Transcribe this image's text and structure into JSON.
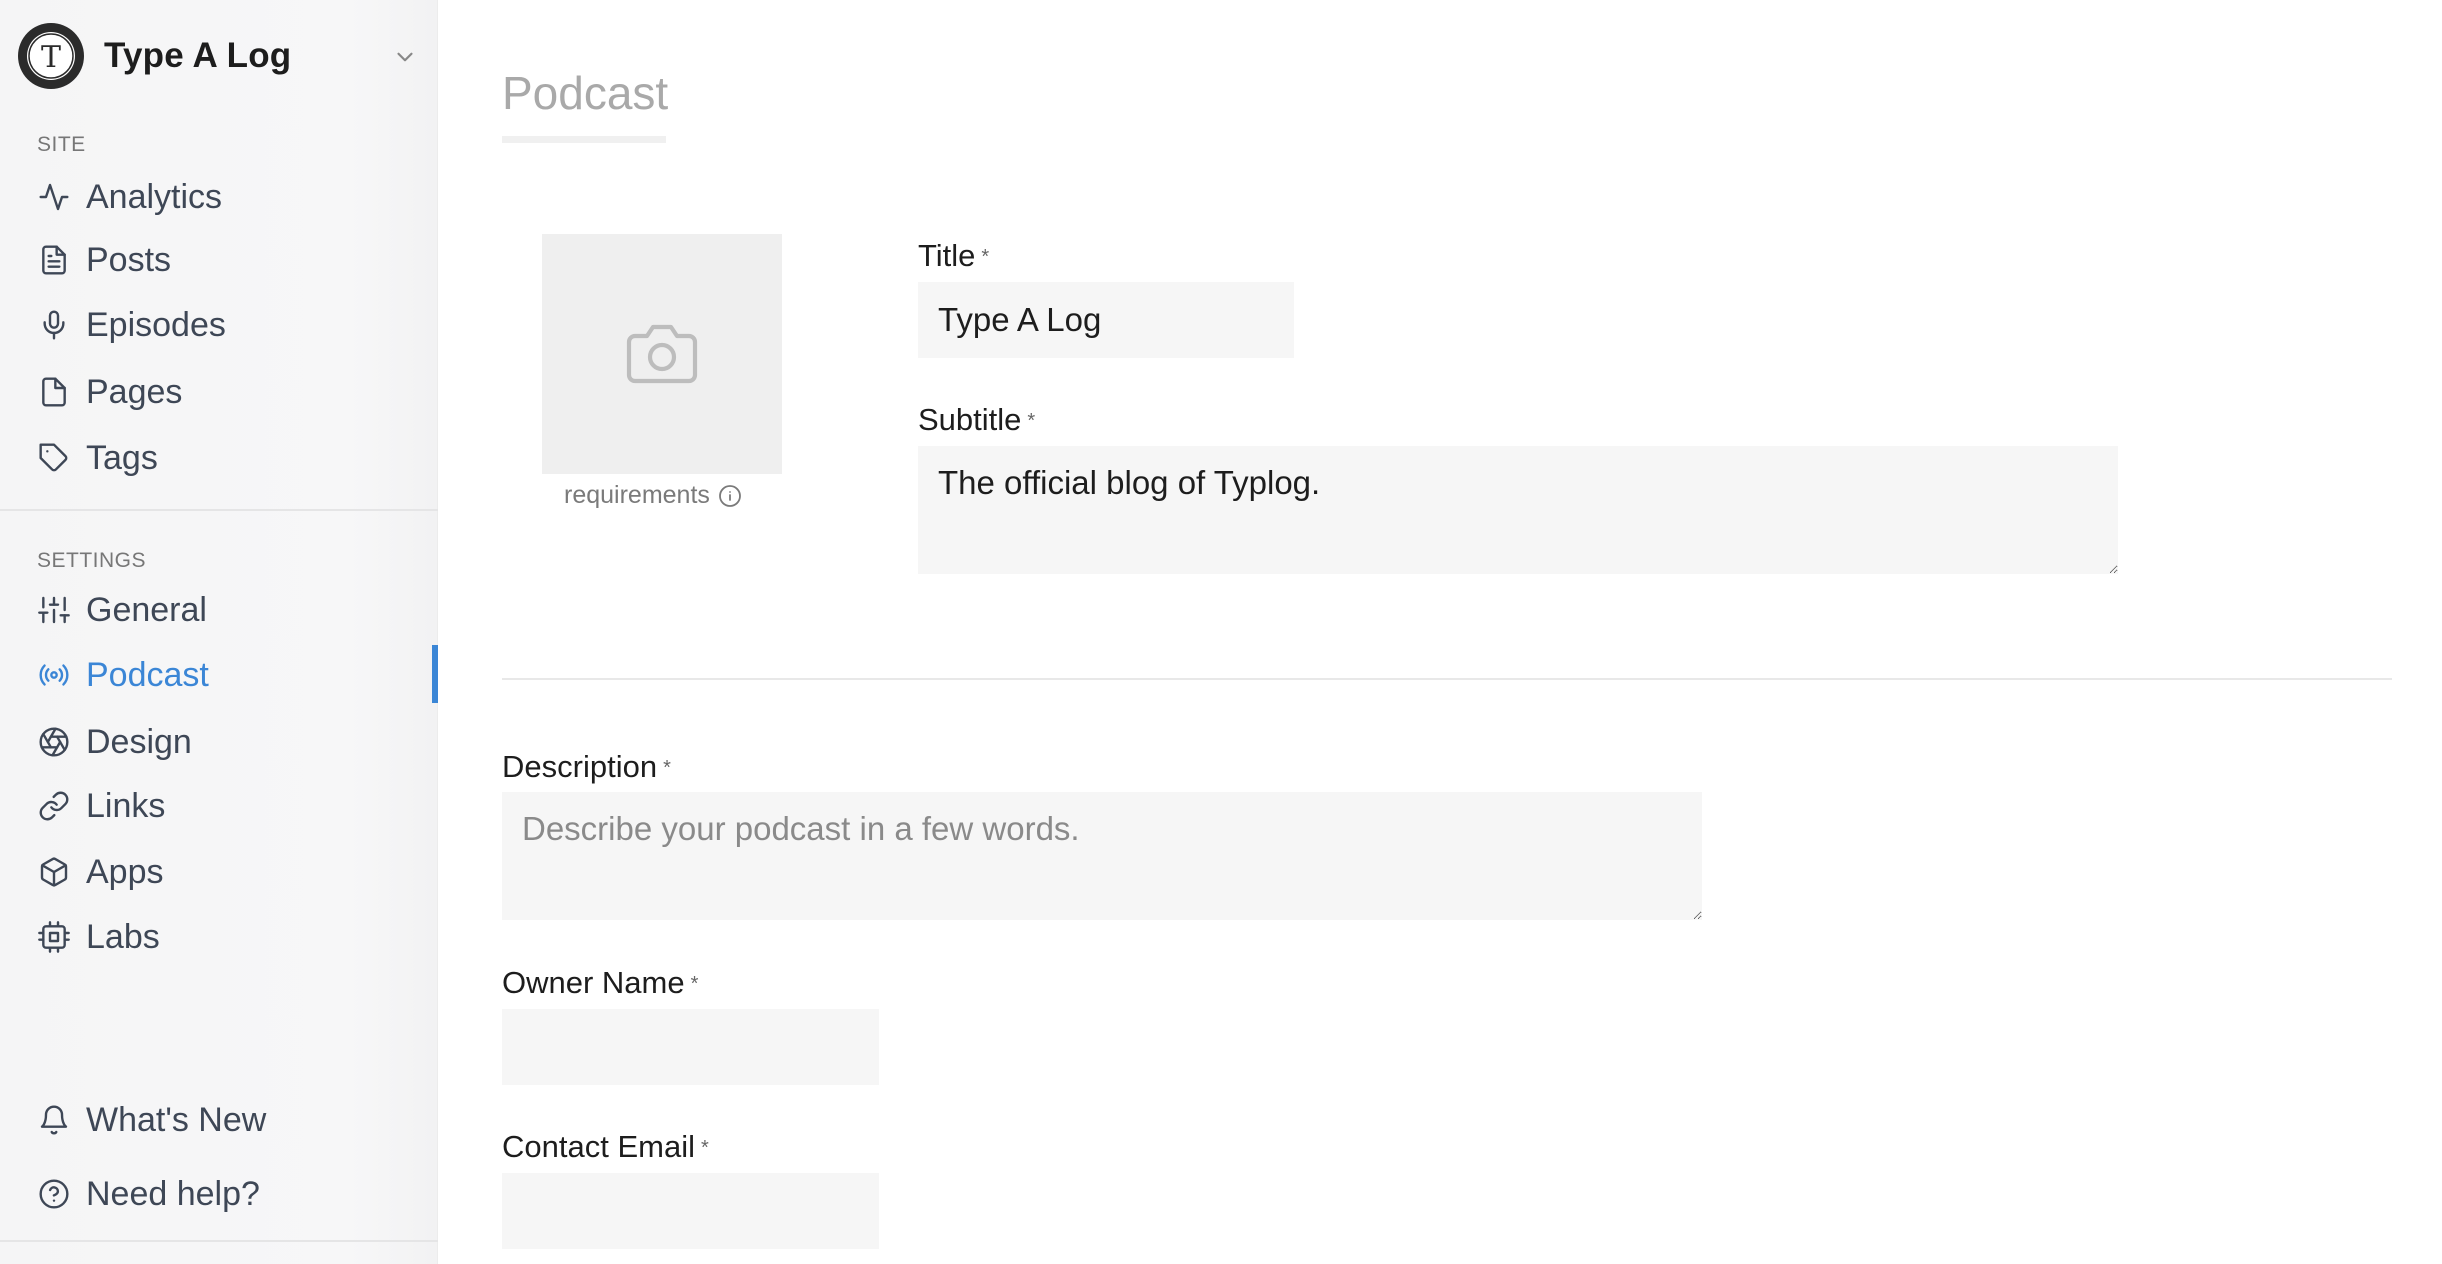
{
  "brand": {
    "name": "Type A Log",
    "logo_letter": "T"
  },
  "sidebar": {
    "site_label": "SITE",
    "site_items": [
      {
        "label": "Analytics",
        "icon": "activity-icon"
      },
      {
        "label": "Posts",
        "icon": "document-icon"
      },
      {
        "label": "Episodes",
        "icon": "microphone-icon"
      },
      {
        "label": "Pages",
        "icon": "file-icon"
      },
      {
        "label": "Tags",
        "icon": "tag-icon"
      }
    ],
    "settings_label": "SETTINGS",
    "settings_items": [
      {
        "label": "General",
        "icon": "sliders-icon"
      },
      {
        "label": "Podcast",
        "icon": "broadcast-icon",
        "active": true
      },
      {
        "label": "Design",
        "icon": "aperture-icon"
      },
      {
        "label": "Links",
        "icon": "link-icon"
      },
      {
        "label": "Apps",
        "icon": "box-icon"
      },
      {
        "label": "Labs",
        "icon": "cpu-icon"
      }
    ],
    "footer_items": [
      {
        "label": "What's New",
        "icon": "bell-icon"
      },
      {
        "label": "Need help?",
        "icon": "help-circle-icon"
      }
    ],
    "accent_color": "#3b86d6"
  },
  "main": {
    "page_title": "Podcast",
    "cover": {
      "requirements_label": "requirements"
    },
    "fields": {
      "title": {
        "label": "Title",
        "required_mark": "*",
        "value": "Type A Log"
      },
      "subtitle": {
        "label": "Subtitle",
        "required_mark": "*",
        "value": "The official blog of Typlog."
      },
      "description": {
        "label": "Description",
        "required_mark": "*",
        "value": "",
        "placeholder": "Describe your podcast in a few words."
      },
      "owner_name": {
        "label": "Owner Name",
        "required_mark": "*",
        "value": ""
      },
      "contact_email": {
        "label": "Contact Email",
        "required_mark": "*",
        "value": ""
      }
    }
  }
}
